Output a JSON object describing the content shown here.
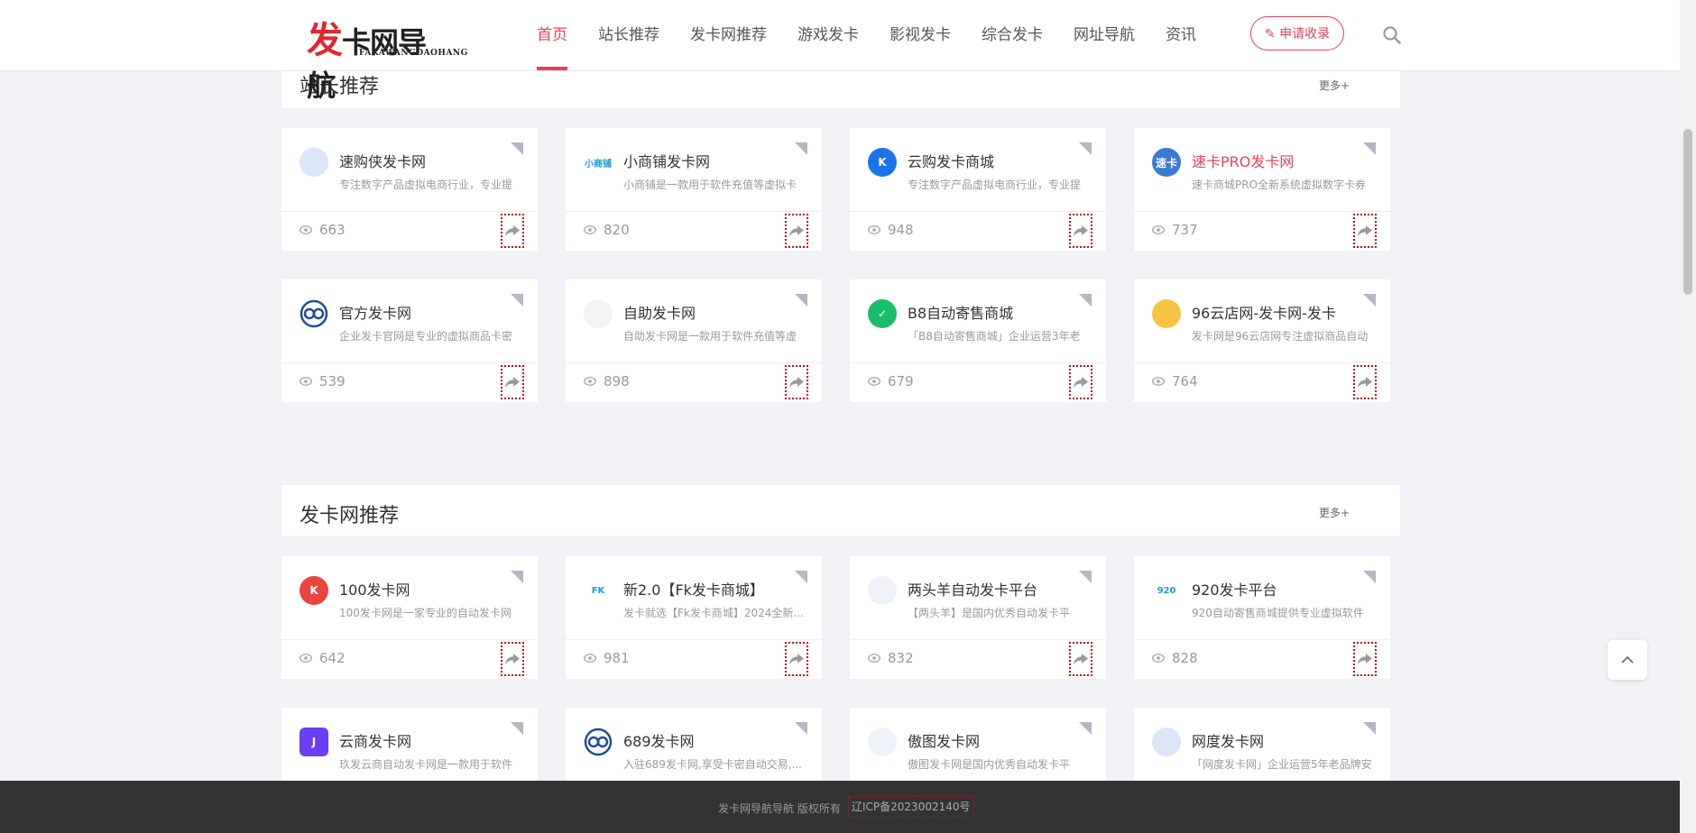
{
  "logo": {
    "first_char": "发",
    "rest": "卡网导航",
    "sub": "FAKAWANGDAOHANG"
  },
  "nav": [
    "首页",
    "站长推荐",
    "发卡网推荐",
    "游戏发卡",
    "影视发卡",
    "综合发卡",
    "网址导航",
    "资讯"
  ],
  "apply_label": "申请收录",
  "sections": [
    {
      "title": "站长推荐",
      "more": "更多+",
      "cards": [
        {
          "name": "速购侠发卡网",
          "desc": "专注数字产品虚拟电商行业，专业提",
          "views": "663",
          "icon": "app-icon",
          "color": "#dbe6f7"
        },
        {
          "name": "小商铺发卡网",
          "desc": "小商铺是一款用于软件充值等虚拟卡",
          "views": "820",
          "icon": "xiaoshangpu-logo",
          "color": "#ffffff",
          "logo_text": "小商铺"
        },
        {
          "name": "云购发卡商城",
          "desc": "专注数字产品虚拟电商行业，专业提",
          "views": "948",
          "icon": "k-logo",
          "color": "#1a73e8",
          "logo_text": "K"
        },
        {
          "name": "速卡PRO发卡网",
          "desc": "速卡商城PRO全新系统虚拟数字卡券",
          "views": "737",
          "icon": "suka-logo",
          "color": "#3a7bd5",
          "logo_text": "速卡",
          "highlight": true
        },
        {
          "name": "官方发卡网",
          "desc": "企业发卡官网是专业的虚拟商品卡密",
          "views": "539",
          "icon": "ring-logo",
          "color": "#ffffff"
        },
        {
          "name": "自助发卡网",
          "desc": "自助发卡网是一款用于软件充值等虚",
          "views": "898",
          "icon": "blank-logo",
          "color": "#f3f3f3"
        },
        {
          "name": "B8自动寄售商城",
          "desc": "「B8自动寄售商城」企业运营3年老",
          "views": "679",
          "icon": "check-logo",
          "color": "#19be6b",
          "logo_text": "✓"
        },
        {
          "name": "96云店网-发卡网-发卡",
          "desc": "发卡网是96云店网专注虚拟商品自动",
          "views": "764",
          "icon": "yellow-logo",
          "color": "#f6c343"
        }
      ]
    },
    {
      "title": "发卡网推荐",
      "more": "更多+",
      "cards": [
        {
          "name": "100发卡网",
          "desc": "100发卡网是一家专业的自动发卡网",
          "views": "642",
          "icon": "k-red-logo",
          "color": "#e8453c",
          "logo_text": "K"
        },
        {
          "name": "新2.0【Fk发卡商城】",
          "desc": "发卡就选【Fk发卡商城】2024全新...",
          "views": "981",
          "icon": "fk-logo",
          "color": "#ffffff",
          "logo_text": "FK"
        },
        {
          "name": "两头羊自动发卡平台",
          "desc": "【两头羊】是国内优秀自动发卡平",
          "views": "832",
          "icon": "sheep-logo",
          "color": "#eef2f8"
        },
        {
          "name": "920发卡平台",
          "desc": "920自动寄售商城提供专业虚拟软件",
          "views": "828",
          "icon": "920-logo",
          "color": "#ffffff",
          "logo_text": "920"
        },
        {
          "name": "云商发卡网",
          "desc": "玖发云商自动发卡网是一款用于软件",
          "views": "",
          "icon": "j-logo",
          "color": "#6c3ef5",
          "logo_text": "J"
        },
        {
          "name": "689发卡网",
          "desc": "入驻689发卡网,享受卡密自动交易,...",
          "views": "",
          "icon": "ring-logo",
          "color": "#ffffff"
        },
        {
          "name": "傲图发卡网",
          "desc": "傲图发卡网是国内优秀自动发卡平",
          "views": "",
          "icon": "aotu-logo",
          "color": "#eef2f8"
        },
        {
          "name": "网度发卡网",
          "desc": "「网度发卡网」企业运营5年老品牌安",
          "views": "",
          "icon": "wave-logo",
          "color": "#dbe6f7"
        }
      ]
    }
  ],
  "footer": {
    "text": "发卡网导航导航 版权所有",
    "icp": "辽ICP备2023002140号"
  }
}
